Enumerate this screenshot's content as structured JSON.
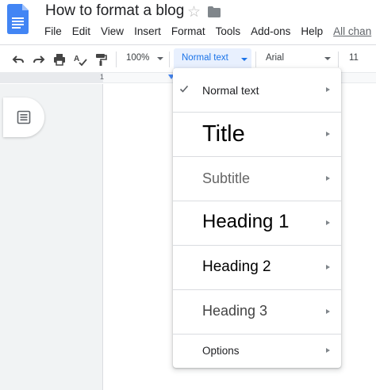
{
  "header": {
    "doc_title": "How to format a blog",
    "menus": [
      "File",
      "Edit",
      "View",
      "Insert",
      "Format",
      "Tools",
      "Add-ons",
      "Help"
    ],
    "all_changes": "All chan"
  },
  "toolbar": {
    "zoom": "100%",
    "style": "Normal text",
    "font": "Arial",
    "font_size": "11"
  },
  "ruler": {
    "mark": "1"
  },
  "style_menu": {
    "selected_index": 0,
    "items": [
      {
        "label": "Normal text"
      },
      {
        "label": "Title"
      },
      {
        "label": "Subtitle"
      },
      {
        "label": "Heading 1"
      },
      {
        "label": "Heading 2"
      },
      {
        "label": "Heading 3"
      },
      {
        "label": "Options"
      }
    ]
  },
  "colors": {
    "accent": "#1a73e8",
    "doc_icon": "#4285f4",
    "selected_bg": "#e8f0fe",
    "panel_bg": "#f1f3f4"
  }
}
